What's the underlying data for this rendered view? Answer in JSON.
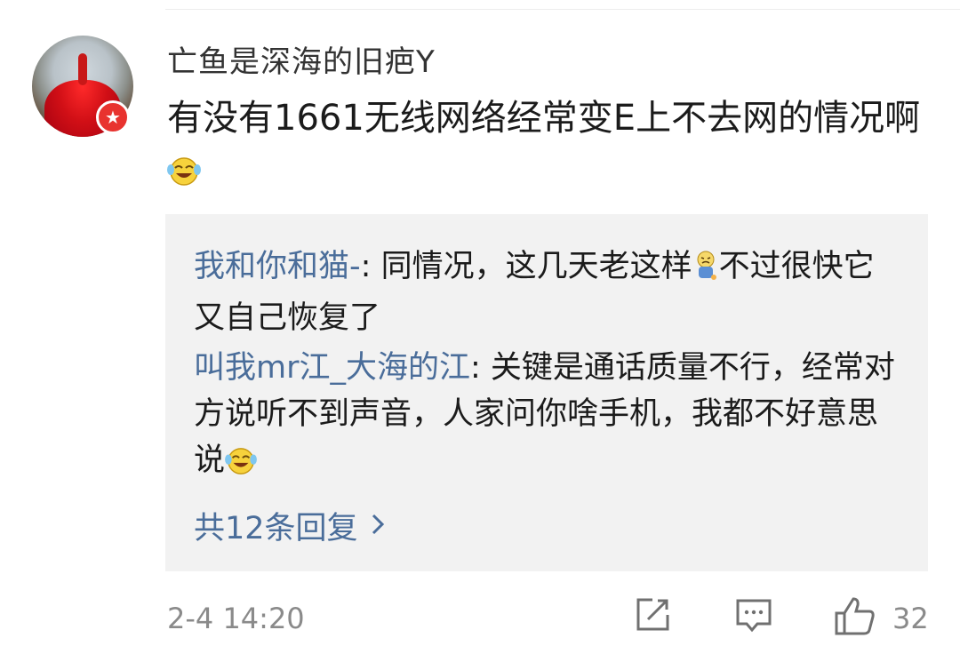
{
  "comment": {
    "username": "亡鱼是深海的旧疤Y",
    "text": "有没有1661无线网络经常变E上不去网的情况啊",
    "emoji": "laugh-cry-emoji",
    "timestamp": "2-4 14:20",
    "like_count": "32"
  },
  "replies": [
    {
      "name": "我和你和猫-",
      "separator": ": ",
      "text_before_emoji": "同情况，这几天老这样",
      "emoji": "sad-kid-emoji",
      "text_after_emoji": "不过很快它又自己恢复了"
    },
    {
      "name": "叫我mr江_大海的江",
      "separator": ": ",
      "text": "关键是通话质量不行，经常对方说听不到声音，人家问你啥手机，我都不好意思说",
      "emoji": "laugh-cry-emoji"
    }
  ],
  "more_replies": {
    "label": "共12条回复",
    "icon": "chevron-right-icon"
  },
  "actions": {
    "share_icon": "share-icon",
    "comment_icon": "comment-icon",
    "like_icon": "thumbs-up-icon"
  },
  "colors": {
    "link": "#4a6d9a",
    "badge": "#e8332f",
    "reply_bg": "#f2f2f2",
    "muted": "#8a8a8a"
  }
}
